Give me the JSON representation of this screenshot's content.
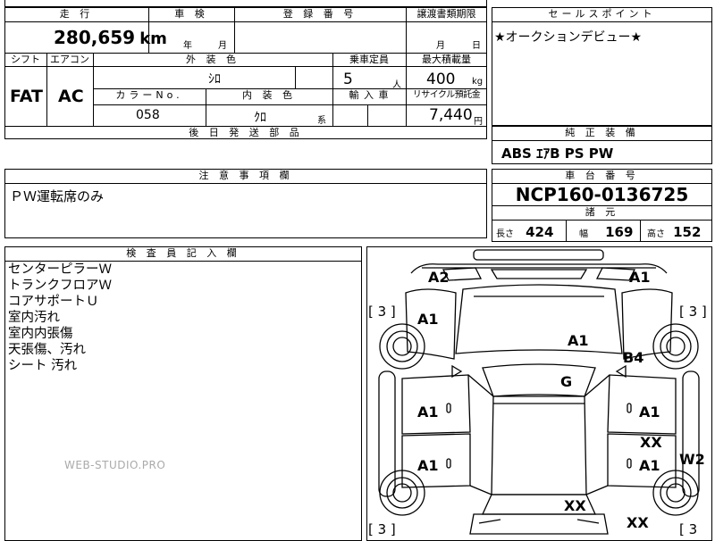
{
  "vehicle_table": {
    "headers": {
      "mileage": "走 行",
      "inspection": "車 検",
      "registration_no": "登 録 番 号",
      "transfer_deadline": "譲渡書類期限",
      "shift": "シフト",
      "aircon": "エアコン",
      "exterior_color": "外 装 色",
      "capacity": "乗車定員",
      "max_load": "最大積載量",
      "color_no": "カラーNo.",
      "interior_color": "内 装 色",
      "import": "輸 入 車",
      "recycle": "リサイクル預託金",
      "later_parts": "後 日 発 送 部 品"
    },
    "mileage_value": "280,659",
    "mileage_unit": "km",
    "inspection_year": "年",
    "inspection_month": "月",
    "transfer_month": "月",
    "transfer_day": "日",
    "shift_value": "FAT",
    "aircon_value": "AC",
    "exterior_color_value": "ｼﾛ",
    "capacity_value": "5",
    "capacity_unit": "人",
    "max_load_value": "400",
    "max_load_unit": "kg",
    "color_no_value": "058",
    "interior_color_value": "ｸﾛ",
    "interior_suffix": "系",
    "recycle_value": "7,440",
    "recycle_unit": "円"
  },
  "sales_point": {
    "header": "セールスポイント",
    "text": "★オークションデビュー★"
  },
  "standard_equipment": {
    "header": "純 正 装 備",
    "text": "ABS ｴｱB PS PW"
  },
  "notes": {
    "header": "注 意 事 項 欄",
    "text": "ＰＷ運転席のみ"
  },
  "chassis": {
    "header": "車 台 番 号",
    "value": "NCP160-0136725",
    "specs_header": "諸 元",
    "length_label": "長さ",
    "length_value": "424",
    "width_label": "幅",
    "width_value": "169",
    "height_label": "高さ",
    "height_value": "152"
  },
  "inspector": {
    "header": "検 査 員 記 入 欄",
    "lines": [
      "センターピラーＷ",
      "トランクフロアＷ",
      "コアサポートＵ",
      "室内汚れ",
      "室内内張傷",
      "天張傷、汚れ",
      "シート 汚れ"
    ]
  },
  "watermark": "WEB-STUDIO.PRO",
  "diagram": {
    "bracket_tl": "[ 3 ]",
    "bracket_tr": "[ 3 ]",
    "bracket_bl": "[ 3 ]",
    "bracket_br": "[ 3",
    "marks": {
      "a2_top_left": "A2",
      "a1_top_right": "A1",
      "a1_left_front": "A1",
      "a1_hood": "A1",
      "b4_right": "B4",
      "g_windshield": "G",
      "a1_left_door1": "A1",
      "a1_right_door1": "A1",
      "xx_right_door2": "XX",
      "a1_left_door2": "A1",
      "a1_right_door2": "A1",
      "w2_right": "W2",
      "xx_trunk": "XX",
      "xx_rear_right": "XX"
    }
  }
}
